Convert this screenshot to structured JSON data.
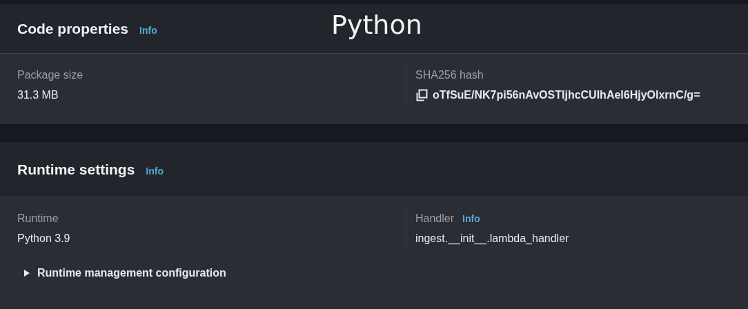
{
  "annotation": "Python",
  "panels": [
    {
      "title": "Code properties",
      "info": "Info",
      "fields": [
        {
          "label": "Package size",
          "value": "31.3 MB"
        },
        {
          "label": "SHA256 hash",
          "value": "oTfSuE/NK7pi56nAvOSTIjhcCUIhAel6HjyOlxrnC/g=",
          "copyable": true
        }
      ]
    },
    {
      "title": "Runtime settings",
      "info": "Info",
      "fields": [
        {
          "label": "Runtime",
          "value": "Python 3.9"
        },
        {
          "label": "Handler",
          "label_info": "Info",
          "value": "ingest.__init__.lambda_handler"
        }
      ],
      "expander": {
        "label": "Runtime management configuration",
        "expanded": false
      }
    }
  ]
}
